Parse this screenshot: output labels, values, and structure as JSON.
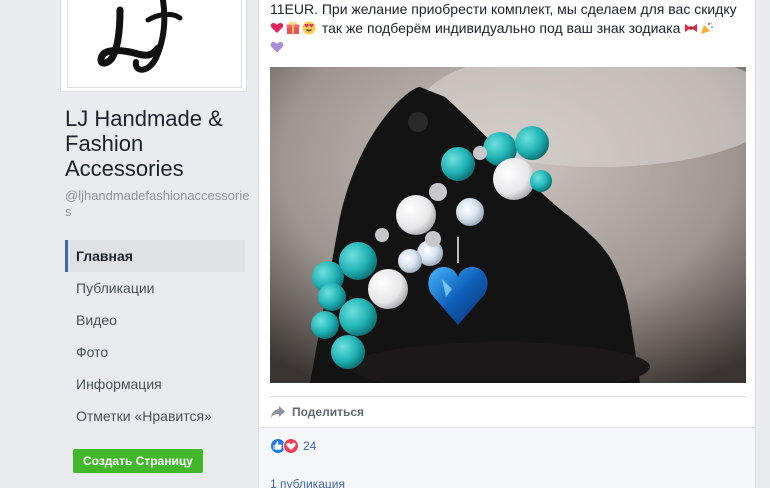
{
  "page": {
    "name": "LJ Handmade & Fashion Accessories",
    "handle": "@ljhandmadefashionaccessories",
    "logo_text": "LJ"
  },
  "nav": {
    "items": [
      {
        "label": "Главная",
        "active": true
      },
      {
        "label": "Публикации"
      },
      {
        "label": "Видео"
      },
      {
        "label": "Фото"
      },
      {
        "label": "Информация"
      },
      {
        "label": "Отметки «Нравится»"
      }
    ]
  },
  "create_button": "Создать Страницу",
  "post": {
    "text_line1": "11EUR. При желание приобрести комплект, мы сделаем для вас скидку",
    "text_line2": "так же подберём индивидуально под ваш знак зодиака",
    "emojis": [
      "heart-icon",
      "gift-icon",
      "heart-eyes-icon",
      "bow-icon",
      "party-popper-icon",
      "purple-heart-icon"
    ],
    "share_label": "Поделиться",
    "reaction_count": "24",
    "publications_link": "1 публикация"
  },
  "colors": {
    "accent": "#4267b2",
    "create_button": "#42b72a",
    "like": "#1877f2",
    "love": "#f33e58"
  }
}
